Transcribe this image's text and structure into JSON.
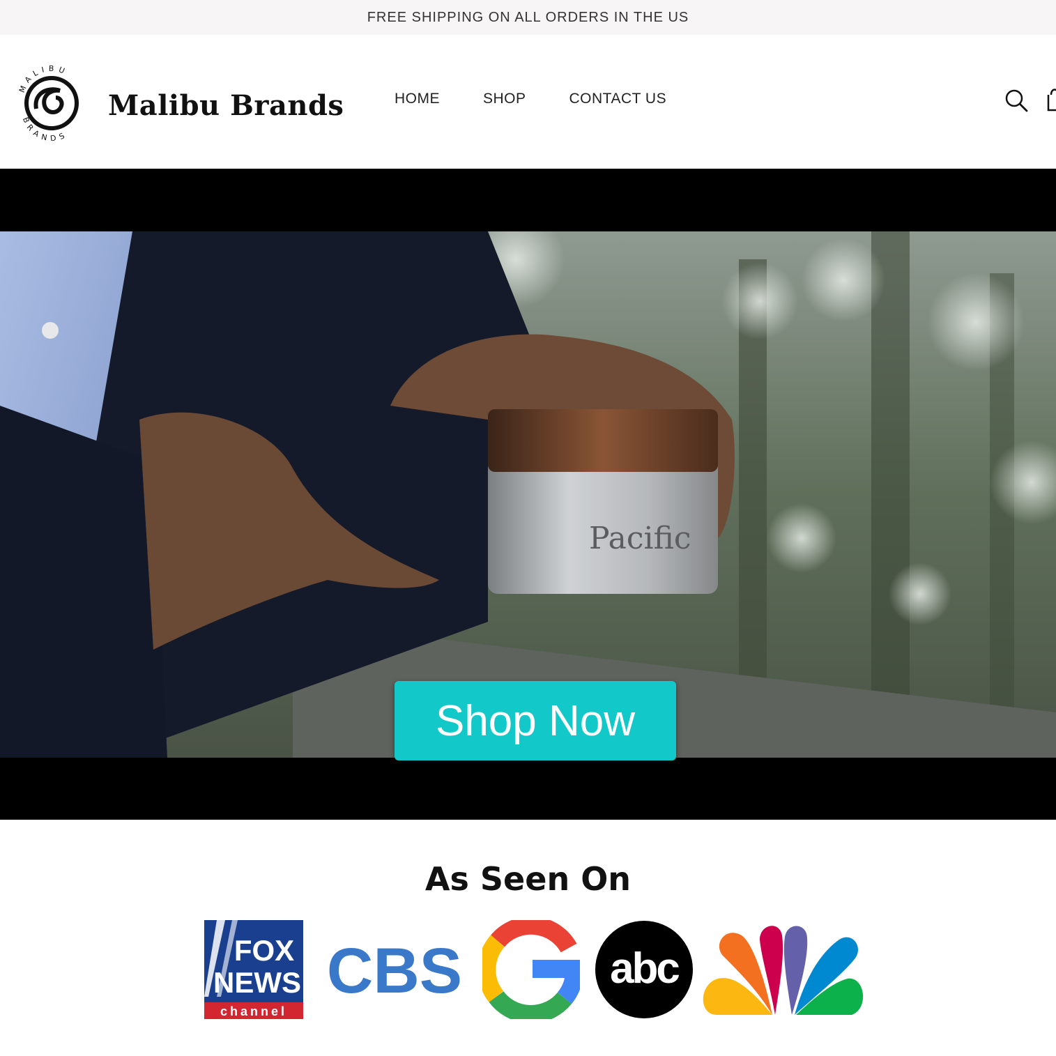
{
  "announcement": {
    "text": "FREE SHIPPING ON ALL ORDERS IN THE US"
  },
  "header": {
    "logo_ring_top": "MALIBU",
    "logo_ring_bottom": "BRANDS",
    "brand_name": "Malibu Brands",
    "nav": [
      {
        "label": "HOME"
      },
      {
        "label": "SHOP"
      },
      {
        "label": "CONTACT US"
      }
    ],
    "icons": [
      "search-icon",
      "cart-icon"
    ]
  },
  "hero": {
    "product_label": "Pacific",
    "cta_label": "Shop Now",
    "cta_color": "#12c8c8"
  },
  "as_seen_on": {
    "title": "As Seen On",
    "logos": [
      {
        "name": "fox-news",
        "line1": "FOX",
        "line2": "NEWS",
        "line3": "channel"
      },
      {
        "name": "cbs",
        "text": "CBS"
      },
      {
        "name": "google",
        "text": "G"
      },
      {
        "name": "abc",
        "text": "abc"
      },
      {
        "name": "nbc",
        "text": ""
      }
    ]
  }
}
